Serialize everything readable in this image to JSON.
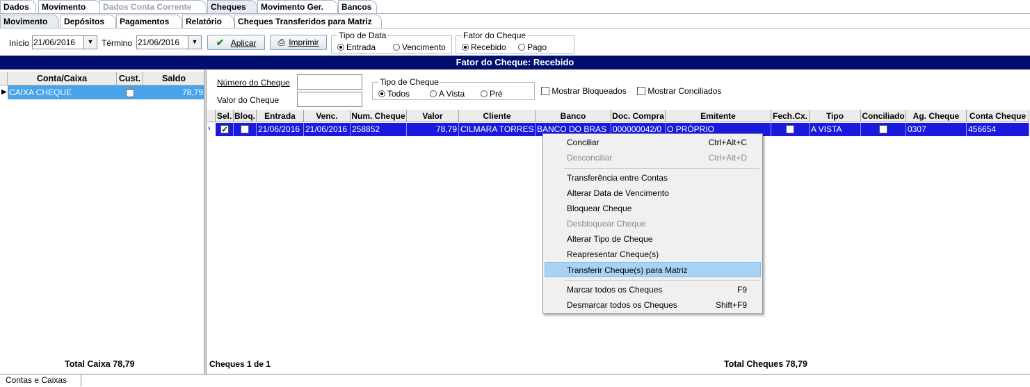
{
  "top_tabs": [
    "Dados",
    "Movimento",
    "Dados Conta Corrente",
    "Cheques",
    "Movimento Ger.",
    "Bancos"
  ],
  "sub_tabs": [
    "Movimento",
    "Depósitos",
    "Pagamentos",
    "Relatório",
    "Cheques Transferidos para Matriz"
  ],
  "toolbar": {
    "inicio_label": "Início",
    "inicio_value": "21/06/2016",
    "termino_label": "Término",
    "termino_value": "21/06/2016",
    "aplicar_label": "Aplicar",
    "imprimir_label": "Imprimir",
    "tipo_data": {
      "title": "Tipo de Data",
      "options": [
        "Entrada",
        "Vencimento"
      ],
      "selected": "Entrada"
    },
    "fator_cheque": {
      "title": "Fator do Cheque",
      "options": [
        "Recebido",
        "Pago"
      ],
      "selected": "Recebido"
    }
  },
  "header_bar": "Fator do Cheque: Recebido",
  "left_panel": {
    "columns": [
      "Conta/Caixa",
      "Cust.",
      "Saldo"
    ],
    "rows": [
      {
        "conta": "CAIXA CHEQUE",
        "saldo": "78,79"
      }
    ],
    "total": "Total Caixa 78,79"
  },
  "filters": {
    "numero_label": "Número do Cheque",
    "valor_label": "Valor do Cheque",
    "tipo_cheque": {
      "title": "Tipo de Cheque",
      "options": [
        "Todos",
        "A Vista",
        "Pré"
      ],
      "selected": "Todos"
    },
    "mostrar_bloqueados": "Mostrar Bloqueados",
    "mostrar_conciliados": "Mostrar Conciliados"
  },
  "grid": {
    "columns": [
      "Sel.",
      "Bloq.",
      "Entrada",
      "Venc.",
      "Num. Cheque",
      "Valor",
      "Cliente",
      "Banco",
      "Doc. Compra",
      "Emitente",
      "Fech.Cx.",
      "Tipo",
      "Conciliado",
      "Ag. Cheque",
      "Conta Cheque"
    ],
    "row": {
      "entrada": "21/06/2016",
      "venc": "21/06/2016",
      "num": "258852",
      "valor": "78,79",
      "cliente": "CILMARA TORRES",
      "banco": "BANCO DO BRAS",
      "doc": "000000042/0",
      "emitente": "O PRÓPRIO",
      "tipo": "A VISTA",
      "ag": "0307",
      "conta": "456654"
    },
    "counter": "Cheques 1 de 1",
    "total": "Total Cheques 78,79"
  },
  "context_menu": [
    {
      "label": "Conciliar",
      "shortcut": "Ctrl+Alt+C",
      "enabled": true
    },
    {
      "label": "Desconciliar",
      "shortcut": "Ctrl+Alt+D",
      "enabled": false
    },
    {
      "label": "Transferência entre Contas",
      "shortcut": "",
      "enabled": true
    },
    {
      "label": "Alterar Data de Vencimento",
      "shortcut": "",
      "enabled": true
    },
    {
      "label": "Bloquear Cheque",
      "shortcut": "",
      "enabled": true
    },
    {
      "label": "Desbloquear Cheque",
      "shortcut": "",
      "enabled": false
    },
    {
      "label": "Alterar Tipo de Cheque",
      "shortcut": "",
      "enabled": true
    },
    {
      "label": "Reapresentar Cheque(s)",
      "shortcut": "",
      "enabled": true
    },
    {
      "label": "Transferir Cheque(s) para Matriz",
      "shortcut": "",
      "enabled": true
    },
    {
      "label": "Marcar todos os Cheques",
      "shortcut": "F9",
      "enabled": true
    },
    {
      "label": "Desmarcar todos os Cheques",
      "shortcut": "Shift+F9",
      "enabled": true
    }
  ],
  "status_tab": "Contas e Caixas",
  "colors": {
    "header_bar": "#000e6e",
    "grid_selection": "#1a1adf",
    "left_selection": "#4aa3e8",
    "menu_highlight": "#a9d3f5"
  }
}
